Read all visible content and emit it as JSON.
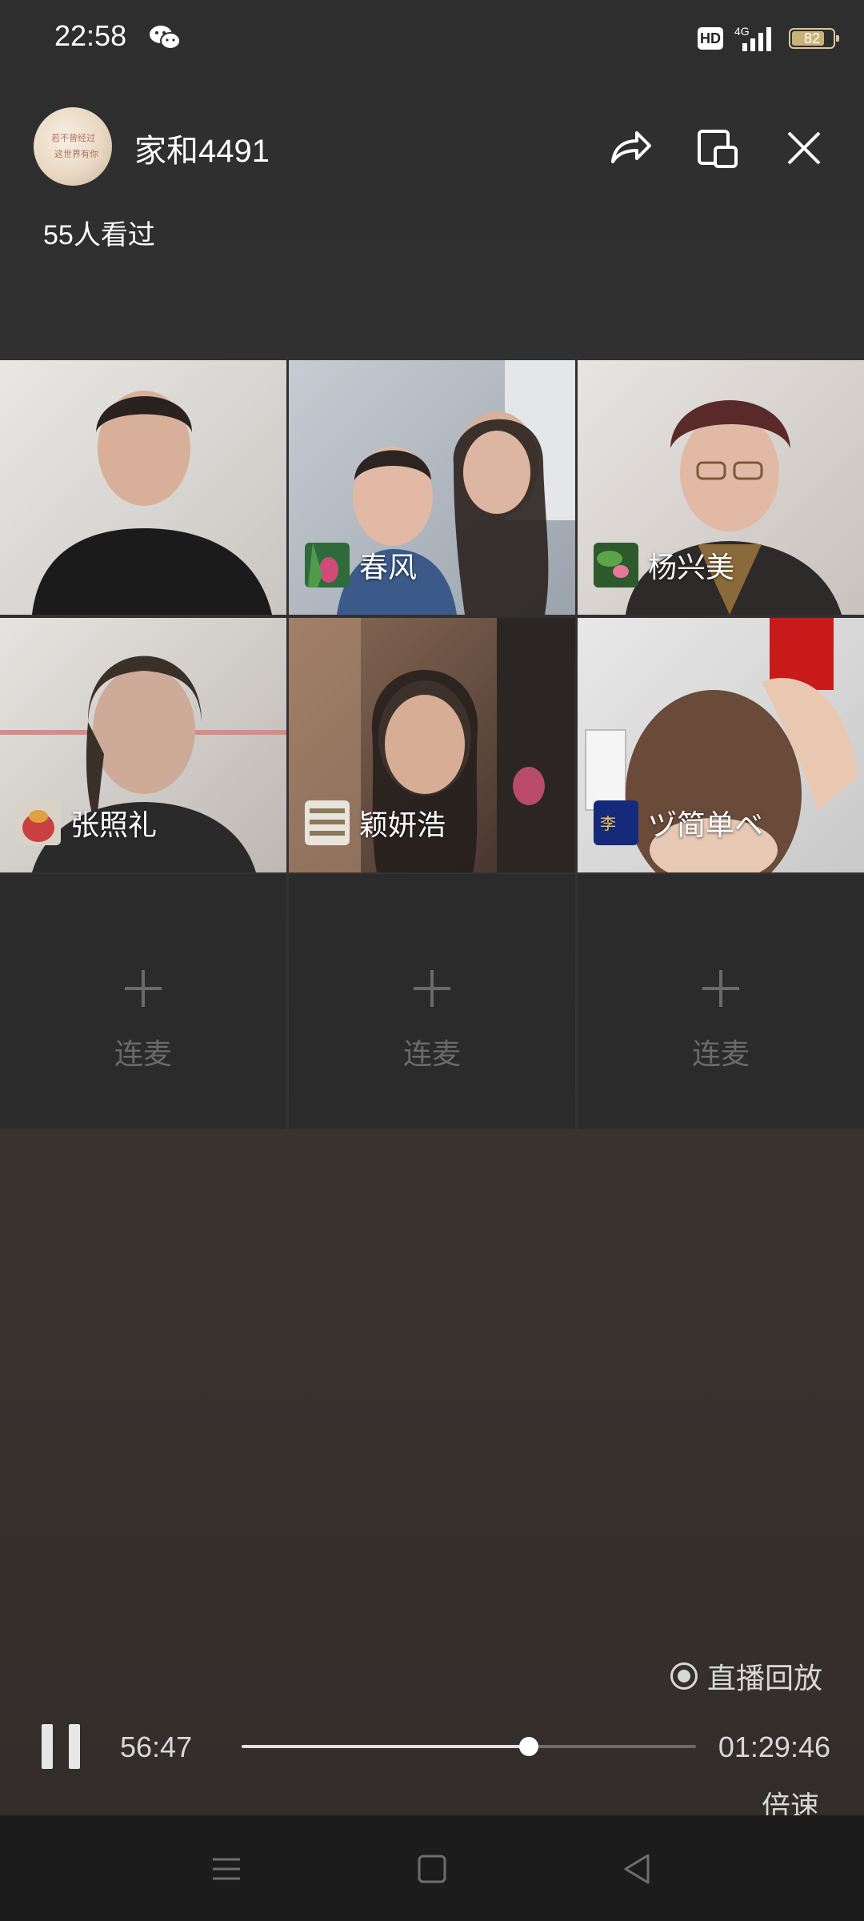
{
  "status_bar": {
    "time": "22:58",
    "hd": "HD",
    "network": "4G",
    "battery": "82",
    "battery_level": 0.82
  },
  "host": {
    "name": "家和4491",
    "viewers": "55人看过",
    "avatar_text_1": "若不曾经过",
    "avatar_text_2": "这世界有你"
  },
  "participants": [
    {
      "name": ""
    },
    {
      "name": "春风"
    },
    {
      "name": "杨兴美"
    },
    {
      "name": "张照礼"
    },
    {
      "name": "颖妍浩"
    },
    {
      "name": "ヅ简单ベ"
    }
  ],
  "empty_slots": [
    {
      "label": "连麦"
    },
    {
      "label": "连麦"
    },
    {
      "label": "连麦"
    }
  ],
  "player": {
    "replay_label": "直播回放",
    "current_time": "56:47",
    "total_time": "01:29:46",
    "progress": 0.632,
    "speed_label": "倍速"
  },
  "colors": {
    "accent": "#ffffff",
    "muted": "#6a6a6a",
    "nav_bg": "#1c1c1c"
  }
}
